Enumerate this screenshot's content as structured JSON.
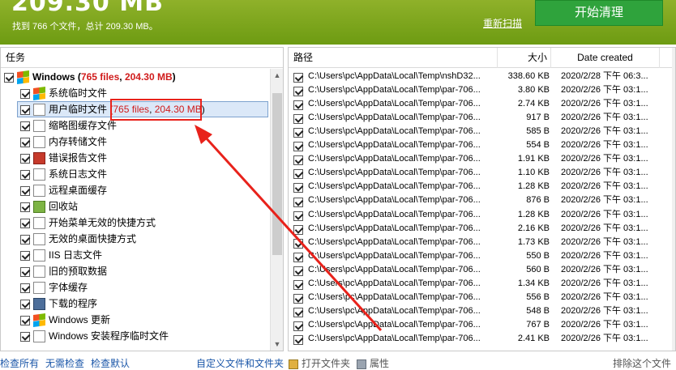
{
  "header": {
    "big_size": "209.30 MB",
    "found_text": "找到 766 个文件，总计 209.30 MB。",
    "rescan_label": "重新扫描",
    "start_label": "开始清理"
  },
  "left": {
    "title": "任务",
    "root": {
      "label": "Windows",
      "paren_open": " (",
      "files": "765 files",
      "comma": ", ",
      "size": "204.30 MB",
      "paren_close": ")"
    },
    "items": [
      {
        "label": "系统临时文件",
        "icon": "windows-flag-icon"
      },
      {
        "label": "用户临时文件",
        "icon": "temp-file-icon",
        "extra": {
          "open": "(",
          "files": "765 files",
          "comma": ", ",
          "size": "204.30 MB",
          "close": ")"
        }
      },
      {
        "label": "缩略图缓存文件",
        "icon": "thumbnail-icon"
      },
      {
        "label": "内存转储文件",
        "icon": "memory-dump-icon"
      },
      {
        "label": "错误报告文件",
        "icon": "error-report-icon"
      },
      {
        "label": "系统日志文件",
        "icon": "log-file-icon"
      },
      {
        "label": "远程桌面缓存",
        "icon": "remote-desktop-icon"
      },
      {
        "label": "回收站",
        "icon": "recycle-bin-icon"
      },
      {
        "label": "开始菜单无效的快捷方式",
        "icon": "shortcut-icon"
      },
      {
        "label": "无效的桌面快捷方式",
        "icon": "desktop-shortcut-icon"
      },
      {
        "label": "IIS 日志文件",
        "icon": "iis-log-icon"
      },
      {
        "label": "旧的预取数据",
        "icon": "prefetch-icon"
      },
      {
        "label": "字体缓存",
        "icon": "font-cache-icon"
      },
      {
        "label": "下载的程序",
        "icon": "downloaded-program-icon"
      },
      {
        "label": "Windows 更新",
        "icon": "windows-update-icon"
      },
      {
        "label": "Windows 安装程序临时文件",
        "icon": "installer-temp-icon"
      }
    ]
  },
  "grid": {
    "col_path": "路径",
    "col_size": "大小",
    "col_date": "Date created",
    "rows": [
      {
        "path": "C:\\Users\\pc\\AppData\\Local\\Temp\\nshD32...",
        "size": "338.60 KB",
        "date": "2020/2/28 下午 06:3..."
      },
      {
        "path": "C:\\Users\\pc\\AppData\\Local\\Temp\\par-706...",
        "size": "3.80 KB",
        "date": "2020/2/26 下午 03:1..."
      },
      {
        "path": "C:\\Users\\pc\\AppData\\Local\\Temp\\par-706...",
        "size": "2.74 KB",
        "date": "2020/2/26 下午 03:1..."
      },
      {
        "path": "C:\\Users\\pc\\AppData\\Local\\Temp\\par-706...",
        "size": "917 B",
        "date": "2020/2/26 下午 03:1..."
      },
      {
        "path": "C:\\Users\\pc\\AppData\\Local\\Temp\\par-706...",
        "size": "585 B",
        "date": "2020/2/26 下午 03:1..."
      },
      {
        "path": "C:\\Users\\pc\\AppData\\Local\\Temp\\par-706...",
        "size": "554 B",
        "date": "2020/2/26 下午 03:1..."
      },
      {
        "path": "C:\\Users\\pc\\AppData\\Local\\Temp\\par-706...",
        "size": "1.91 KB",
        "date": "2020/2/26 下午 03:1..."
      },
      {
        "path": "C:\\Users\\pc\\AppData\\Local\\Temp\\par-706...",
        "size": "1.10 KB",
        "date": "2020/2/26 下午 03:1..."
      },
      {
        "path": "C:\\Users\\pc\\AppData\\Local\\Temp\\par-706...",
        "size": "1.28 KB",
        "date": "2020/2/26 下午 03:1..."
      },
      {
        "path": "C:\\Users\\pc\\AppData\\Local\\Temp\\par-706...",
        "size": "876 B",
        "date": "2020/2/26 下午 03:1..."
      },
      {
        "path": "C:\\Users\\pc\\AppData\\Local\\Temp\\par-706...",
        "size": "1.28 KB",
        "date": "2020/2/26 下午 03:1..."
      },
      {
        "path": "C:\\Users\\pc\\AppData\\Local\\Temp\\par-706...",
        "size": "2.16 KB",
        "date": "2020/2/26 下午 03:1..."
      },
      {
        "path": "C:\\Users\\pc\\AppData\\Local\\Temp\\par-706...",
        "size": "1.73 KB",
        "date": "2020/2/26 下午 03:1..."
      },
      {
        "path": "C:\\Users\\pc\\AppData\\Local\\Temp\\par-706...",
        "size": "550 B",
        "date": "2020/2/26 下午 03:1..."
      },
      {
        "path": "C:\\Users\\pc\\AppData\\Local\\Temp\\par-706...",
        "size": "560 B",
        "date": "2020/2/26 下午 03:1..."
      },
      {
        "path": "C:\\Users\\pc\\AppData\\Local\\Temp\\par-706...",
        "size": "1.34 KB",
        "date": "2020/2/26 下午 03:1..."
      },
      {
        "path": "C:\\Users\\pc\\AppData\\Local\\Temp\\par-706...",
        "size": "556 B",
        "date": "2020/2/26 下午 03:1..."
      },
      {
        "path": "C:\\Users\\pc\\AppData\\Local\\Temp\\par-706...",
        "size": "548 B",
        "date": "2020/2/26 下午 03:1..."
      },
      {
        "path": "C:\\Users\\pc\\AppData\\Local\\Temp\\par-706...",
        "size": "767 B",
        "date": "2020/2/26 下午 03:1..."
      },
      {
        "path": "C:\\Users\\pc\\AppData\\Local\\Temp\\par-706...",
        "size": "2.41 KB",
        "date": "2020/2/26 下午 03:1..."
      }
    ]
  },
  "bottom": {
    "check_all": "检查所有",
    "check_none": "无需检查",
    "check_default": "检查默认",
    "custom_files": "自定义文件和文件夹",
    "open_folder": "打开文件夹",
    "properties": "属性",
    "exclude_file": "排除这个文件"
  },
  "colors": {
    "accent_green": "#6d9b12",
    "start_button": "#2fa33c",
    "annotation_red": "#e8221b",
    "size_red": "#d01b1b"
  }
}
